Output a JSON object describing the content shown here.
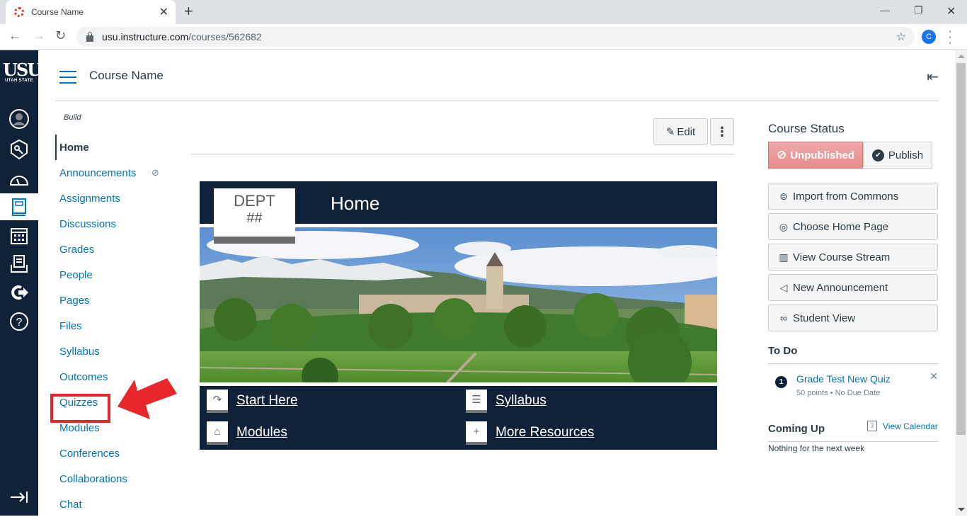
{
  "browser": {
    "tab_title": "Course Name",
    "url_host": "usu.instructure.com",
    "url_path": "/courses/562682",
    "profile_initial": "C"
  },
  "global_nav": {
    "logo_text": "USU",
    "logo_subtext": "UTAH STATE",
    "items": [
      {
        "icon": "account-icon",
        "label": "Account"
      },
      {
        "icon": "admin-icon",
        "label": "Admin"
      },
      {
        "icon": "dashboard-icon",
        "label": "Dashboard"
      },
      {
        "icon": "courses-icon",
        "label": "Courses",
        "active": true
      },
      {
        "icon": "calendar-icon",
        "label": "Calendar"
      },
      {
        "icon": "inbox-icon",
        "label": "Inbox"
      },
      {
        "icon": "commons-icon",
        "label": "Commons"
      },
      {
        "icon": "help-icon",
        "label": "Help"
      }
    ]
  },
  "header": {
    "course_title": "Course Name"
  },
  "course_nav": {
    "section_label": "Build",
    "items": [
      {
        "label": "Home",
        "active": true
      },
      {
        "label": "Announcements",
        "hidden": true
      },
      {
        "label": "Assignments"
      },
      {
        "label": "Discussions"
      },
      {
        "label": "Grades"
      },
      {
        "label": "People"
      },
      {
        "label": "Pages"
      },
      {
        "label": "Files"
      },
      {
        "label": "Syllabus"
      },
      {
        "label": "Outcomes"
      },
      {
        "label": "Quizzes",
        "highlighted": true
      },
      {
        "label": "Modules"
      },
      {
        "label": "Conferences"
      },
      {
        "label": "Collaborations"
      },
      {
        "label": "Chat"
      }
    ]
  },
  "page_toolbar": {
    "edit_label": "Edit",
    "more_label": "⋮"
  },
  "home_page": {
    "dept_line1": "DEPT",
    "dept_line2": "##",
    "banner_title": "Home",
    "hero_alt": "Utah State University Old Main with mountains",
    "links": [
      {
        "label": "Start Here",
        "icon": "arrow-forward-icon"
      },
      {
        "label": "Syllabus",
        "icon": "syllabus-icon"
      },
      {
        "label": "Modules",
        "icon": "modules-icon"
      },
      {
        "label": "More Resources",
        "icon": "plus-icon"
      }
    ]
  },
  "sidebar": {
    "course_status_title": "Course Status",
    "unpublished_label": "Unpublished",
    "publish_label": "Publish",
    "actions": [
      {
        "label": "Import from Commons",
        "icon": "commons-icon"
      },
      {
        "label": "Choose Home Page",
        "icon": "target-icon"
      },
      {
        "label": "View Course Stream",
        "icon": "stream-icon"
      },
      {
        "label": "New Announcement",
        "icon": "megaphone-icon"
      },
      {
        "label": "Student View",
        "icon": "glasses-icon"
      }
    ],
    "todo_title": "To Do",
    "todo": [
      {
        "count": "1",
        "title": "Grade Test New Quiz",
        "meta": "50 points • No Due Date"
      }
    ],
    "coming_up_title": "Coming Up",
    "view_calendar_label": "View Calendar",
    "calendar_day": "3",
    "coming_up_empty": "Nothing for the next week"
  },
  "colors": {
    "nav_bg": "#0f2239",
    "link": "#0374b5",
    "unpublished": "#e58c8c",
    "annotation": "#e8272d"
  }
}
